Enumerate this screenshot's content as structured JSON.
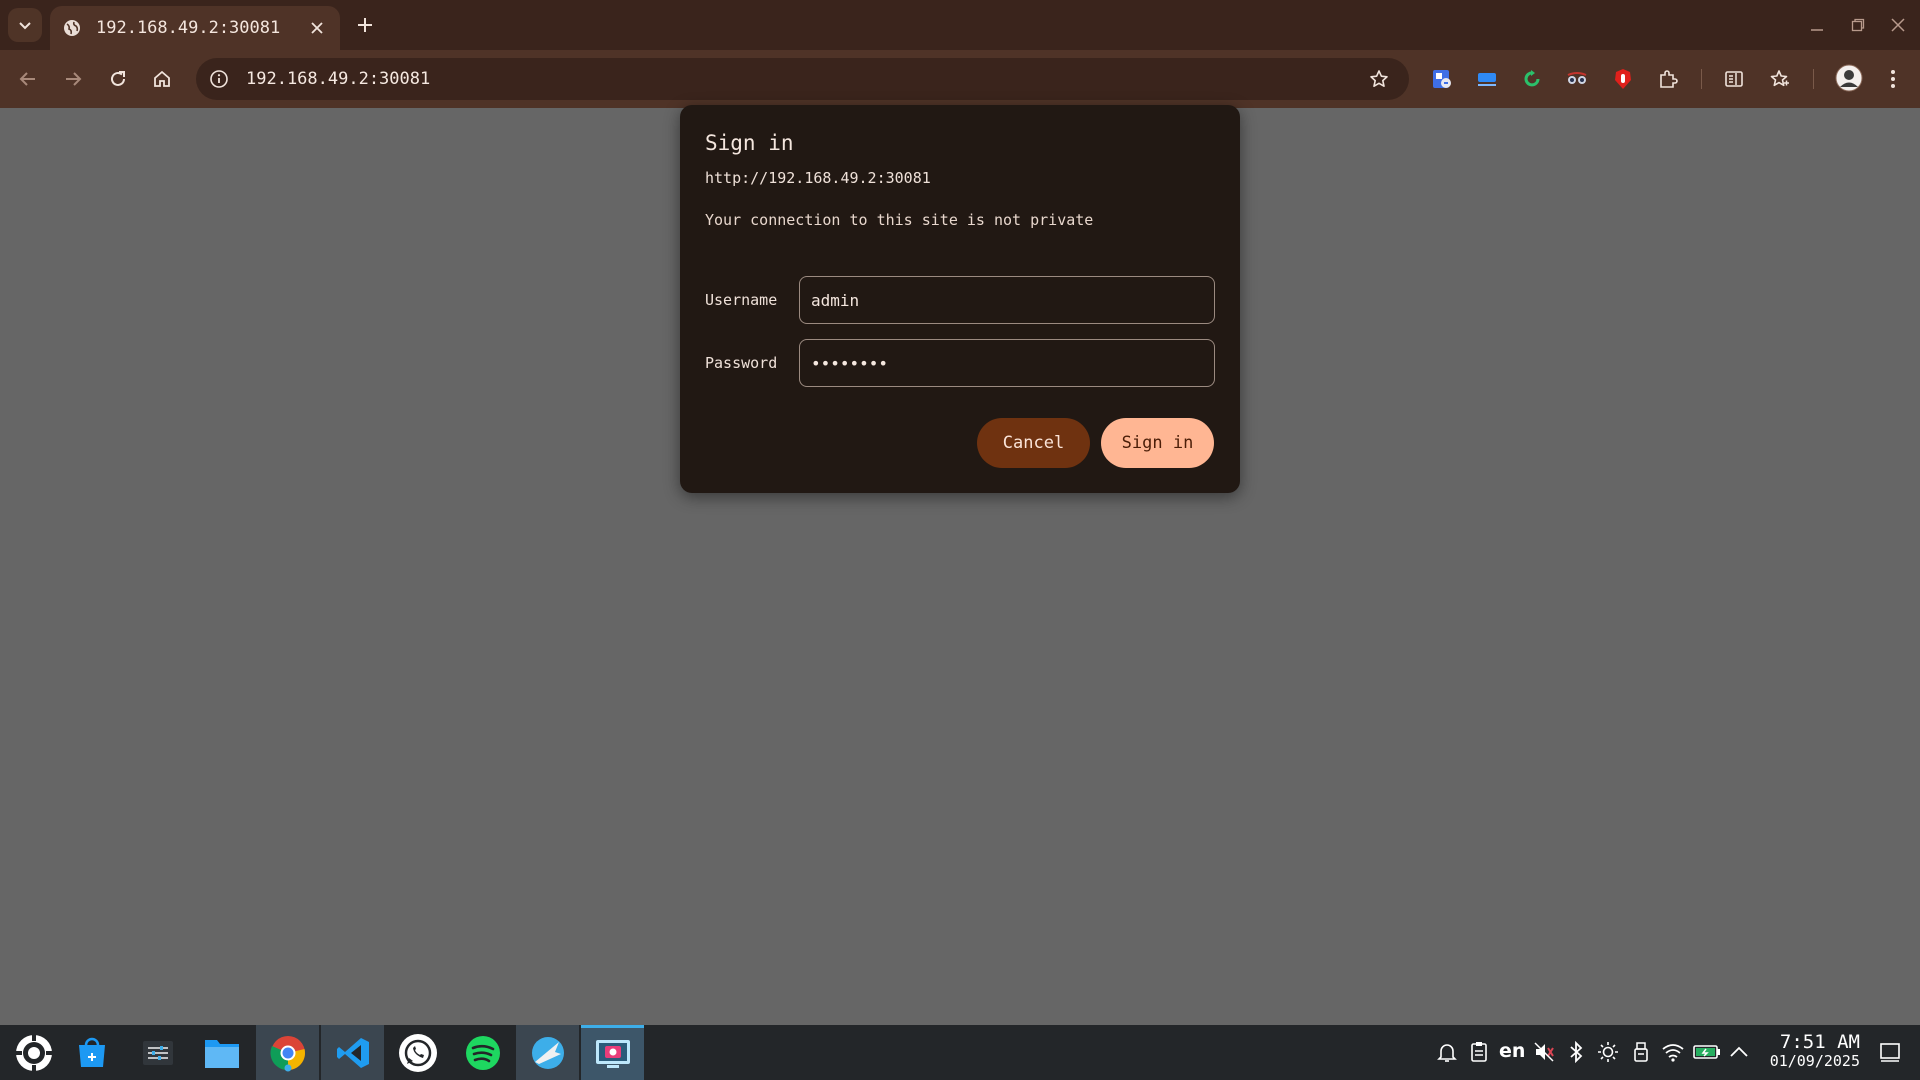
{
  "browser": {
    "tab": {
      "title": "192.168.49.2:30081"
    },
    "address_bar": {
      "url": "192.168.49.2:30081"
    }
  },
  "dialog": {
    "title": "Sign in",
    "origin": "http://192.168.49.2:30081",
    "warning": "Your connection to this site is not private",
    "username_label": "Username",
    "username_value": "admin",
    "password_label": "Password",
    "password_value": "••••••••",
    "cancel_label": "Cancel",
    "signin_label": "Sign in"
  },
  "taskbar": {
    "language": "en",
    "time": "7:51 AM",
    "date": "01/09/2025"
  },
  "colors": {
    "page_background": "#666666",
    "chrome_frame": "#3a241c",
    "toolbar": "#4f3327",
    "dialog_background": "#211813",
    "cancel_button": "#6f3210",
    "signin_button": "#ffb693",
    "taskbar": "#232629"
  }
}
